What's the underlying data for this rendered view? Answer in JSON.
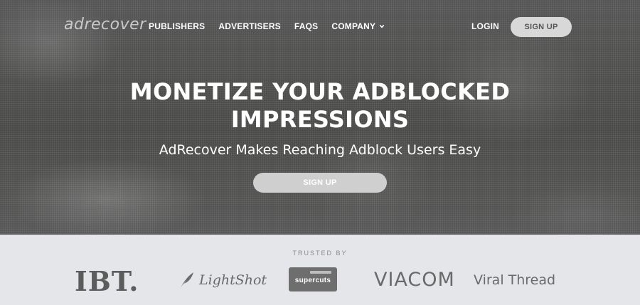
{
  "nav": {
    "logo": "adrecover",
    "links": [
      "PUBLISHERS",
      "ADVERTISERS",
      "FAQS",
      "COMPANY"
    ],
    "company_icon": "chevron-down-icon",
    "login": "LOGIN",
    "signup": "SIGN UP"
  },
  "hero": {
    "headline_line1": "MONETIZE YOUR ADBLOCKED",
    "headline_line2": "IMPRESSIONS",
    "subheadline": "AdRecover Makes Reaching Adblock Users Easy",
    "cta": "SIGN UP"
  },
  "trusted": {
    "label": "TRUSTED BY",
    "brands": {
      "ibt": "IBT.",
      "lightshot": "LightShot",
      "supercuts": "supercuts",
      "viacom": "VIACOM",
      "viral_thread": "Viral Thread"
    }
  },
  "colors": {
    "hero_bg": "#4f4f4d",
    "trusted_bg": "#e4e6ea",
    "button_bg": "#d8d8d8",
    "logo_text": "#c9c9c9",
    "brand_gray": "#6a6a6a"
  }
}
